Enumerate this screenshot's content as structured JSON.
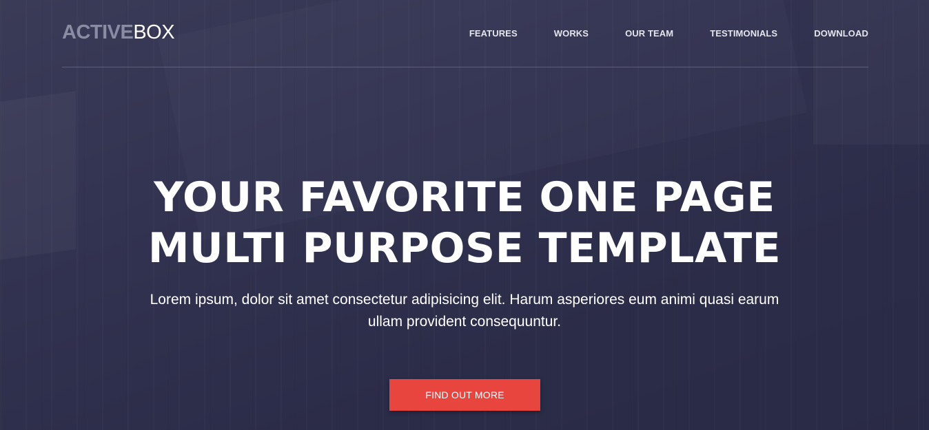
{
  "brand": {
    "strong": "ACTIVE",
    "light": "BOX"
  },
  "nav": {
    "items": [
      {
        "label": "FEATURES"
      },
      {
        "label": "WORKS"
      },
      {
        "label": "OUR TEAM"
      },
      {
        "label": "TESTIMONIALS"
      },
      {
        "label": "DOWNLOAD"
      }
    ]
  },
  "hero": {
    "title_line1": "YOUR FAVORITE ONE PAGE",
    "title_line2": "MULTI PURPOSE TEMPLATE",
    "subtitle": "Lorem ipsum, dolor sit amet consectetur adipisicing elit. Harum asperiores eum animi quasi earum ullam provident consequuntur.",
    "cta_label": "FIND OUT MORE"
  },
  "colors": {
    "background": "#2e2f4d",
    "accent": "#e8453f",
    "logo_strong": "#8a8ca3",
    "text": "#ffffff"
  }
}
